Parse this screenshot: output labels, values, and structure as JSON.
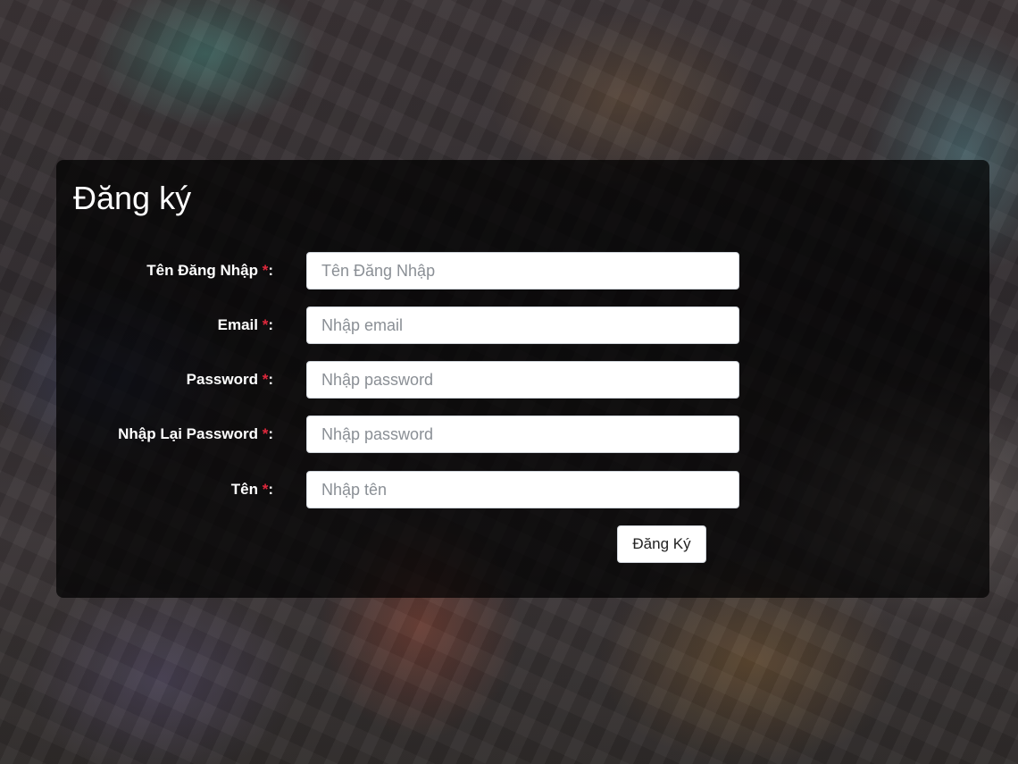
{
  "form": {
    "title": "Đăng ký",
    "required_mark": "*",
    "fields": [
      {
        "label": "Tên Đăng Nhập",
        "placeholder": "Tên Đăng Nhập",
        "value": ""
      },
      {
        "label": "Email",
        "placeholder": "Nhập email",
        "value": ""
      },
      {
        "label": "Password",
        "placeholder": "Nhập password",
        "value": ""
      },
      {
        "label": "Nhập Lại Password",
        "placeholder": "Nhập password",
        "value": ""
      },
      {
        "label": "Tên",
        "placeholder": "Nhập tên",
        "value": ""
      }
    ],
    "submit_label": "Đăng Ký"
  },
  "colors": {
    "required": "#e0283c",
    "panel_background": "rgba(0,0,0,0.72)"
  }
}
